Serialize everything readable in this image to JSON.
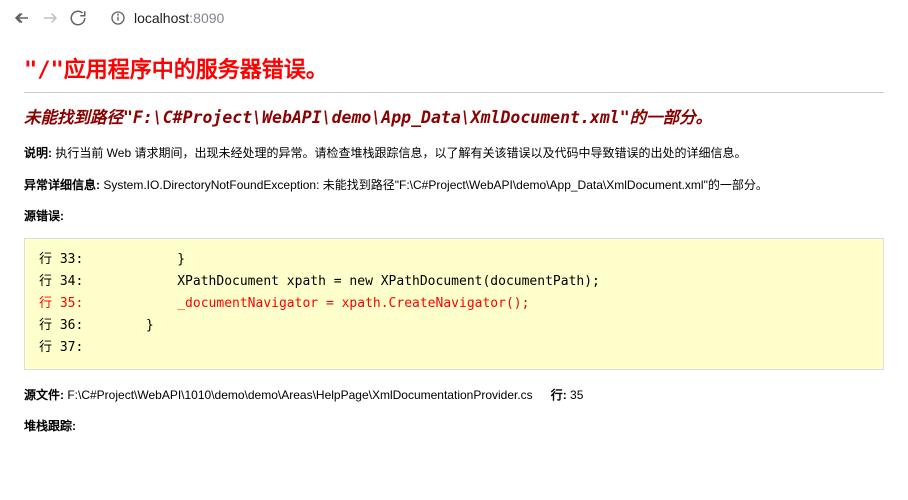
{
  "url": {
    "host": "localhost",
    "port": ":8090"
  },
  "error": {
    "server_title": "\"/\"应用程序中的服务器错误。",
    "exception_message": "未能找到路径\"F:\\C#Project\\WebAPI\\demo\\App_Data\\XmlDocument.xml\"的一部分。",
    "description_label": "说明: ",
    "description_text": "执行当前 Web 请求期间，出现未经处理的异常。请检查堆栈跟踪信息，以了解有关该错误以及代码中导致错误的出处的详细信息。",
    "exception_detail_label": "异常详细信息: ",
    "exception_detail_text": "System.IO.DirectoryNotFoundException: 未能找到路径\"F:\\C#Project\\WebAPI\\demo\\App_Data\\XmlDocument.xml\"的一部分。",
    "source_error_label": "源错误:",
    "code_lines": [
      {
        "num": "行 33:",
        "text": "            }",
        "highlight": false
      },
      {
        "num": "行 34:",
        "text": "            XPathDocument xpath = new XPathDocument(documentPath);",
        "highlight": false
      },
      {
        "num": "行 35:",
        "text": "            _documentNavigator = xpath.CreateNavigator();",
        "highlight": true
      },
      {
        "num": "行 36:",
        "text": "        }",
        "highlight": false
      },
      {
        "num": "行 37:",
        "text": "",
        "highlight": false
      }
    ],
    "source_file_label": "源文件: ",
    "source_file_path": "F:\\C#Project\\WebAPI\\1010\\demo\\demo\\Areas\\HelpPage\\XmlDocumentationProvider.cs",
    "line_label": "行: ",
    "line_number": "35",
    "stack_trace_label": "堆栈跟踪:"
  }
}
